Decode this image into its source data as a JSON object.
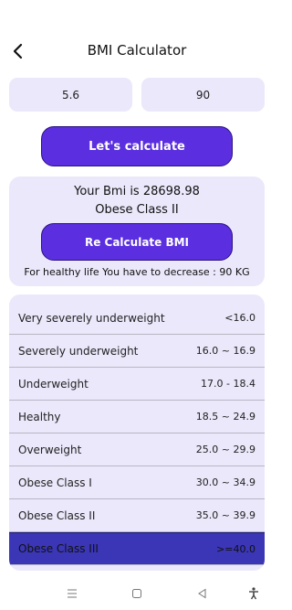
{
  "header": {
    "title": "BMI Calculator",
    "back_icon": "back-arrow-icon"
  },
  "inputs": {
    "height_value": "5.6",
    "weight_value": "90"
  },
  "buttons": {
    "calculate_label": "Let's calculate",
    "recalculate_label": "Re Calculate BMI"
  },
  "result": {
    "bmi_text": "Your Bmi is  28698.98",
    "classification": "Obese Class II",
    "advice": "For healthy life You have to decrease :  90 KG"
  },
  "bmi_table": [
    {
      "label": "Very severely underweight",
      "range": "<16.0"
    },
    {
      "label": "Severely underweight",
      "range": "16.0 ~ 16.9"
    },
    {
      "label": "Underweight",
      "range": "17.0 - 18.4"
    },
    {
      "label": "Healthy",
      "range": "18.5 ~ 24.9"
    },
    {
      "label": "Overweight",
      "range": "25.0 ~ 29.9"
    },
    {
      "label": "Obese Class I",
      "range": "30.0 ~ 34.9"
    },
    {
      "label": "Obese Class II",
      "range": "35.0 ~ 39.9"
    },
    {
      "label": "Obese Class III",
      "range": ">=40.0"
    }
  ],
  "active_row_index": 7,
  "colors": {
    "accent": "#5b2fe0",
    "card_background": "#ebe8fb",
    "active_row": "#3a36b5"
  },
  "nav_icons": [
    "menu-icon",
    "home-icon",
    "back-icon",
    "accessibility-icon"
  ]
}
